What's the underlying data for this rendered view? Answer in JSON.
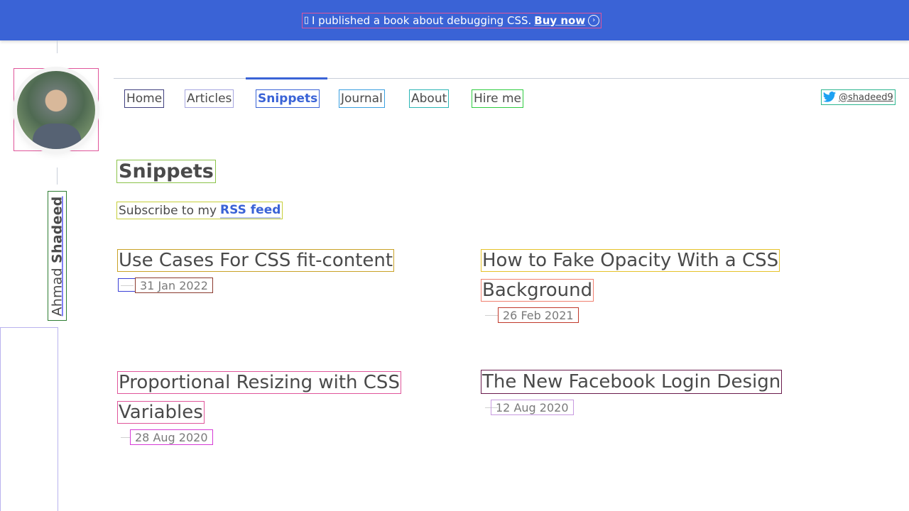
{
  "banner": {
    "glyph": "▯",
    "text": "I published a book about debugging CSS.",
    "cta": "Buy now",
    "arrow": "›"
  },
  "author": {
    "first_name": "Ahmad",
    "last_name": "Shadeed"
  },
  "nav": {
    "items": [
      {
        "label": "Home",
        "active": false
      },
      {
        "label": "Articles",
        "active": false
      },
      {
        "label": "Snippets",
        "active": true
      },
      {
        "label": "Journal",
        "active": false
      },
      {
        "label": "About",
        "active": false
      },
      {
        "label": "Hire me",
        "active": false
      }
    ],
    "twitter_handle": "@shadeed9"
  },
  "page": {
    "title": "Snippets",
    "subscribe_text": "Subscribe to my",
    "rss_label": "RSS feed"
  },
  "posts": [
    {
      "title_line1": "Use Cases For CSS fit-content",
      "title_line2": "",
      "date": "31 Jan 2022"
    },
    {
      "title_line1": "How to Fake Opacity With a CSS",
      "title_line2": "Background",
      "date": "26 Feb 2021"
    },
    {
      "title_line1": "Proportional Resizing with CSS",
      "title_line2": "Variables",
      "date": "28 Aug 2020"
    },
    {
      "title_line1": "The New Facebook Login Design",
      "title_line2": "",
      "date": "12 Aug 2020"
    }
  ],
  "colors": {
    "accent": "#3a63d6",
    "text": "#4a4a4a",
    "muted": "#7a7a7a",
    "twitter": "#1da1f2"
  }
}
